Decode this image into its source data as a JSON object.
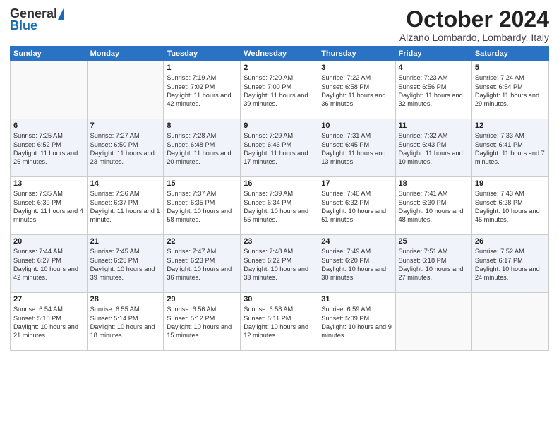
{
  "logo": {
    "general": "General",
    "blue": "Blue"
  },
  "title": "October 2024",
  "subtitle": "Alzano Lombardo, Lombardy, Italy",
  "headers": [
    "Sunday",
    "Monday",
    "Tuesday",
    "Wednesday",
    "Thursday",
    "Friday",
    "Saturday"
  ],
  "weeks": [
    [
      {
        "day": "",
        "content": ""
      },
      {
        "day": "",
        "content": ""
      },
      {
        "day": "1",
        "content": "Sunrise: 7:19 AM\nSunset: 7:02 PM\nDaylight: 11 hours and 42 minutes."
      },
      {
        "day": "2",
        "content": "Sunrise: 7:20 AM\nSunset: 7:00 PM\nDaylight: 11 hours and 39 minutes."
      },
      {
        "day": "3",
        "content": "Sunrise: 7:22 AM\nSunset: 6:58 PM\nDaylight: 11 hours and 36 minutes."
      },
      {
        "day": "4",
        "content": "Sunrise: 7:23 AM\nSunset: 6:56 PM\nDaylight: 11 hours and 32 minutes."
      },
      {
        "day": "5",
        "content": "Sunrise: 7:24 AM\nSunset: 6:54 PM\nDaylight: 11 hours and 29 minutes."
      }
    ],
    [
      {
        "day": "6",
        "content": "Sunrise: 7:25 AM\nSunset: 6:52 PM\nDaylight: 11 hours and 26 minutes."
      },
      {
        "day": "7",
        "content": "Sunrise: 7:27 AM\nSunset: 6:50 PM\nDaylight: 11 hours and 23 minutes."
      },
      {
        "day": "8",
        "content": "Sunrise: 7:28 AM\nSunset: 6:48 PM\nDaylight: 11 hours and 20 minutes."
      },
      {
        "day": "9",
        "content": "Sunrise: 7:29 AM\nSunset: 6:46 PM\nDaylight: 11 hours and 17 minutes."
      },
      {
        "day": "10",
        "content": "Sunrise: 7:31 AM\nSunset: 6:45 PM\nDaylight: 11 hours and 13 minutes."
      },
      {
        "day": "11",
        "content": "Sunrise: 7:32 AM\nSunset: 6:43 PM\nDaylight: 11 hours and 10 minutes."
      },
      {
        "day": "12",
        "content": "Sunrise: 7:33 AM\nSunset: 6:41 PM\nDaylight: 11 hours and 7 minutes."
      }
    ],
    [
      {
        "day": "13",
        "content": "Sunrise: 7:35 AM\nSunset: 6:39 PM\nDaylight: 11 hours and 4 minutes."
      },
      {
        "day": "14",
        "content": "Sunrise: 7:36 AM\nSunset: 6:37 PM\nDaylight: 11 hours and 1 minute."
      },
      {
        "day": "15",
        "content": "Sunrise: 7:37 AM\nSunset: 6:35 PM\nDaylight: 10 hours and 58 minutes."
      },
      {
        "day": "16",
        "content": "Sunrise: 7:39 AM\nSunset: 6:34 PM\nDaylight: 10 hours and 55 minutes."
      },
      {
        "day": "17",
        "content": "Sunrise: 7:40 AM\nSunset: 6:32 PM\nDaylight: 10 hours and 51 minutes."
      },
      {
        "day": "18",
        "content": "Sunrise: 7:41 AM\nSunset: 6:30 PM\nDaylight: 10 hours and 48 minutes."
      },
      {
        "day": "19",
        "content": "Sunrise: 7:43 AM\nSunset: 6:28 PM\nDaylight: 10 hours and 45 minutes."
      }
    ],
    [
      {
        "day": "20",
        "content": "Sunrise: 7:44 AM\nSunset: 6:27 PM\nDaylight: 10 hours and 42 minutes."
      },
      {
        "day": "21",
        "content": "Sunrise: 7:45 AM\nSunset: 6:25 PM\nDaylight: 10 hours and 39 minutes."
      },
      {
        "day": "22",
        "content": "Sunrise: 7:47 AM\nSunset: 6:23 PM\nDaylight: 10 hours and 36 minutes."
      },
      {
        "day": "23",
        "content": "Sunrise: 7:48 AM\nSunset: 6:22 PM\nDaylight: 10 hours and 33 minutes."
      },
      {
        "day": "24",
        "content": "Sunrise: 7:49 AM\nSunset: 6:20 PM\nDaylight: 10 hours and 30 minutes."
      },
      {
        "day": "25",
        "content": "Sunrise: 7:51 AM\nSunset: 6:18 PM\nDaylight: 10 hours and 27 minutes."
      },
      {
        "day": "26",
        "content": "Sunrise: 7:52 AM\nSunset: 6:17 PM\nDaylight: 10 hours and 24 minutes."
      }
    ],
    [
      {
        "day": "27",
        "content": "Sunrise: 6:54 AM\nSunset: 5:15 PM\nDaylight: 10 hours and 21 minutes."
      },
      {
        "day": "28",
        "content": "Sunrise: 6:55 AM\nSunset: 5:14 PM\nDaylight: 10 hours and 18 minutes."
      },
      {
        "day": "29",
        "content": "Sunrise: 6:56 AM\nSunset: 5:12 PM\nDaylight: 10 hours and 15 minutes."
      },
      {
        "day": "30",
        "content": "Sunrise: 6:58 AM\nSunset: 5:11 PM\nDaylight: 10 hours and 12 minutes."
      },
      {
        "day": "31",
        "content": "Sunrise: 6:59 AM\nSunset: 5:09 PM\nDaylight: 10 hours and 9 minutes."
      },
      {
        "day": "",
        "content": ""
      },
      {
        "day": "",
        "content": ""
      }
    ]
  ]
}
